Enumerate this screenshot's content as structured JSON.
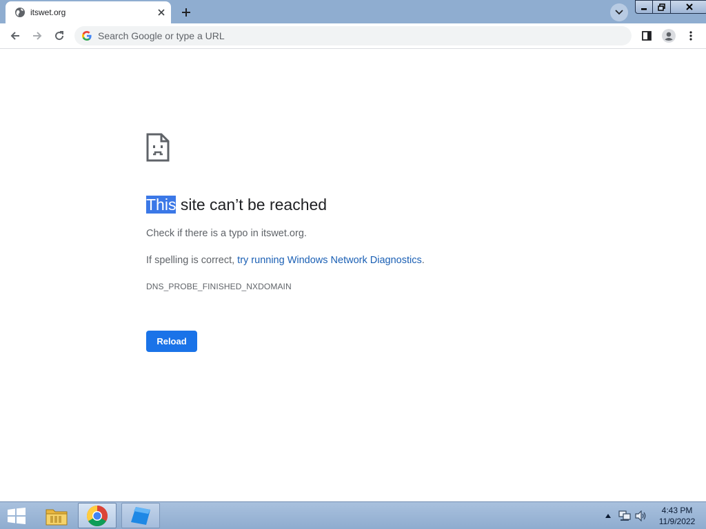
{
  "browser": {
    "tab": {
      "title": "itswet.org"
    },
    "omnibox": {
      "placeholder": "Search Google or type a URL"
    }
  },
  "error_page": {
    "title_selected": "This",
    "title_rest": " site can’t be reached",
    "typo_hint": "Check if there is a typo in itswet.org.",
    "spelling_prefix": "If spelling is correct, ",
    "diagnostics_link": "try running Windows Network Diagnostics",
    "spelling_suffix": ".",
    "error_code": "DNS_PROBE_FINISHED_NXDOMAIN",
    "reload_label": "Reload"
  },
  "taskbar": {
    "apps": [
      "file-explorer-icon",
      "chrome-icon",
      "app-icon"
    ],
    "clock": {
      "time": "4:43 PM",
      "date": "11/9/2022"
    }
  },
  "colors": {
    "accent": "#1a73e8",
    "selection": "#3b78e7",
    "link": "#1a5fb4",
    "tabstrip": "#8fadd0"
  }
}
